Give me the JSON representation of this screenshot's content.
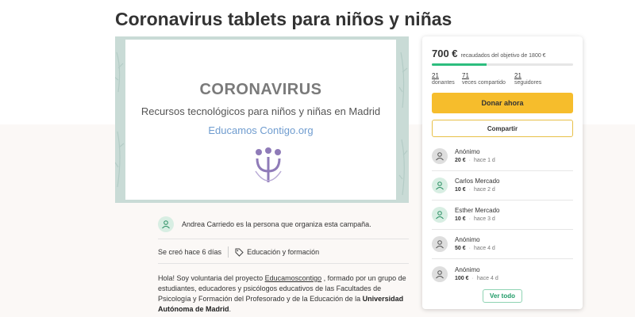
{
  "campaign": {
    "title": "Coronavirus tablets para niños y niñas"
  },
  "hero": {
    "heading": "CORONAVIRUS",
    "subtitle": "Recursos tecnológicos para niños y niñas en Madrid",
    "org": "Educamos Contigo.org"
  },
  "organizer": {
    "text": "Andrea Carriedo es la persona que organiza esta campaña."
  },
  "meta": {
    "created": "Se creó hace 6 días",
    "category": "Educación y formación"
  },
  "description": {
    "intro": "Hola! Soy voluntaria del proyecto ",
    "project_link": "Educamoscontigo",
    "middle": " , formado por un grupo de estudiantes, educadores y psicólogos educativos de las Facultades de Psicología y Formación del Profesorado y de la Educación de la ",
    "university": "Universidad Autónoma de Madrid",
    "end": "."
  },
  "donation_panel": {
    "raised": "700 €",
    "goal_text": "recaudados del objetivo de 1800 €",
    "progress_fraction": 0.39,
    "colors": {
      "progress": "#2dbd7e",
      "donate": "#f6bd2c"
    },
    "stats": [
      {
        "value": "21",
        "label": "donantes"
      },
      {
        "value": "71",
        "label": "veces compartido"
      },
      {
        "value": "21",
        "label": "seguidores"
      }
    ],
    "donate_label": "Donar ahora",
    "share_label": "Compartir",
    "donations": [
      {
        "name": "Anónimo",
        "amount": "20 €",
        "time": "hace 1 d",
        "avatar": "user-icon"
      },
      {
        "name": "Carlos Mercado",
        "amount": "10 €",
        "time": "hace 2 d",
        "avatar": "user-icon"
      },
      {
        "name": "Esther Mercado",
        "amount": "10 €",
        "time": "hace 3 d",
        "avatar": "user-icon"
      },
      {
        "name": "Anónimo",
        "amount": "50 €",
        "time": "hace 4 d",
        "avatar": "user-icon"
      },
      {
        "name": "Anónimo",
        "amount": "100 €",
        "time": "hace 4 d",
        "avatar": "user-icon"
      }
    ],
    "see_all_label": "Ver todo"
  }
}
